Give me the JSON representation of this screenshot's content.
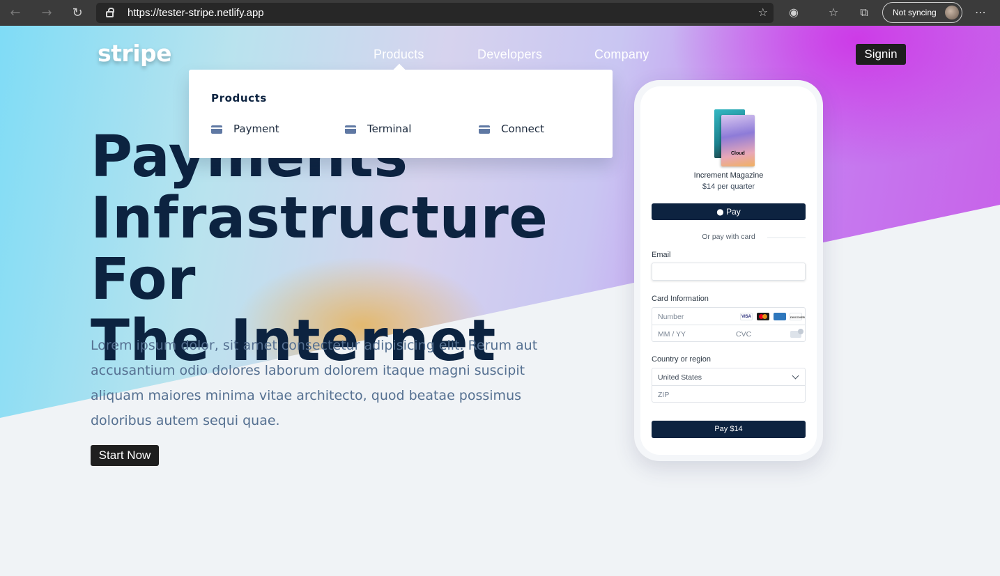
{
  "browser": {
    "url": "https://tester-stripe.netlify.app",
    "sync_label": "Not syncing",
    "icons": [
      "back-arrow-icon",
      "forward-arrow-icon",
      "refresh-icon",
      "lock-icon",
      "add-favorite-icon",
      "tracking-icon",
      "favorites-icon",
      "collections-icon",
      "more-icon"
    ]
  },
  "nav": {
    "logo": "stripe",
    "links": [
      "Products",
      "Developers",
      "Company"
    ],
    "signin_label": "Signin"
  },
  "dropdown": {
    "title": "Products",
    "items": [
      "Payment",
      "Terminal",
      "Connect"
    ]
  },
  "hero": {
    "headline": [
      "Payments",
      "Infrastructure For",
      "The Internet"
    ],
    "lede": "Lorem ipsum dolor, sit amet consectetur adipisicing elit. Rerum aut accusantium odio dolores laborum dolorem itaque magni suscipit aliquam maiores minima vitae architecto, quod beatae possimus doloribus autem sequi quae.",
    "cta_label": "Start Now"
  },
  "checkout": {
    "product_name": "Increment Magazine",
    "cover_text": "Cloud",
    "price": "$14 per quarter",
    "apple_pay_label": "Pay",
    "or_label": "Or pay with card",
    "email_label": "Email",
    "card_label": "Card Information",
    "number_placeholder": "Number",
    "expiry_placeholder": "MM / YY",
    "cvc_placeholder": "CVC",
    "card_brands": [
      "VISA",
      "mastercard",
      "amex",
      "DISCOVER"
    ],
    "country_label": "Country or region",
    "country_value": "United States",
    "zip_placeholder": "ZIP",
    "pay_label": "Pay $14"
  },
  "colors": {
    "navy": "#0d2340",
    "lede": "#557091",
    "button_dark": "#1f1f1f",
    "gradient_start": "#7fdcf6",
    "gradient_end": "#c85ee8"
  }
}
